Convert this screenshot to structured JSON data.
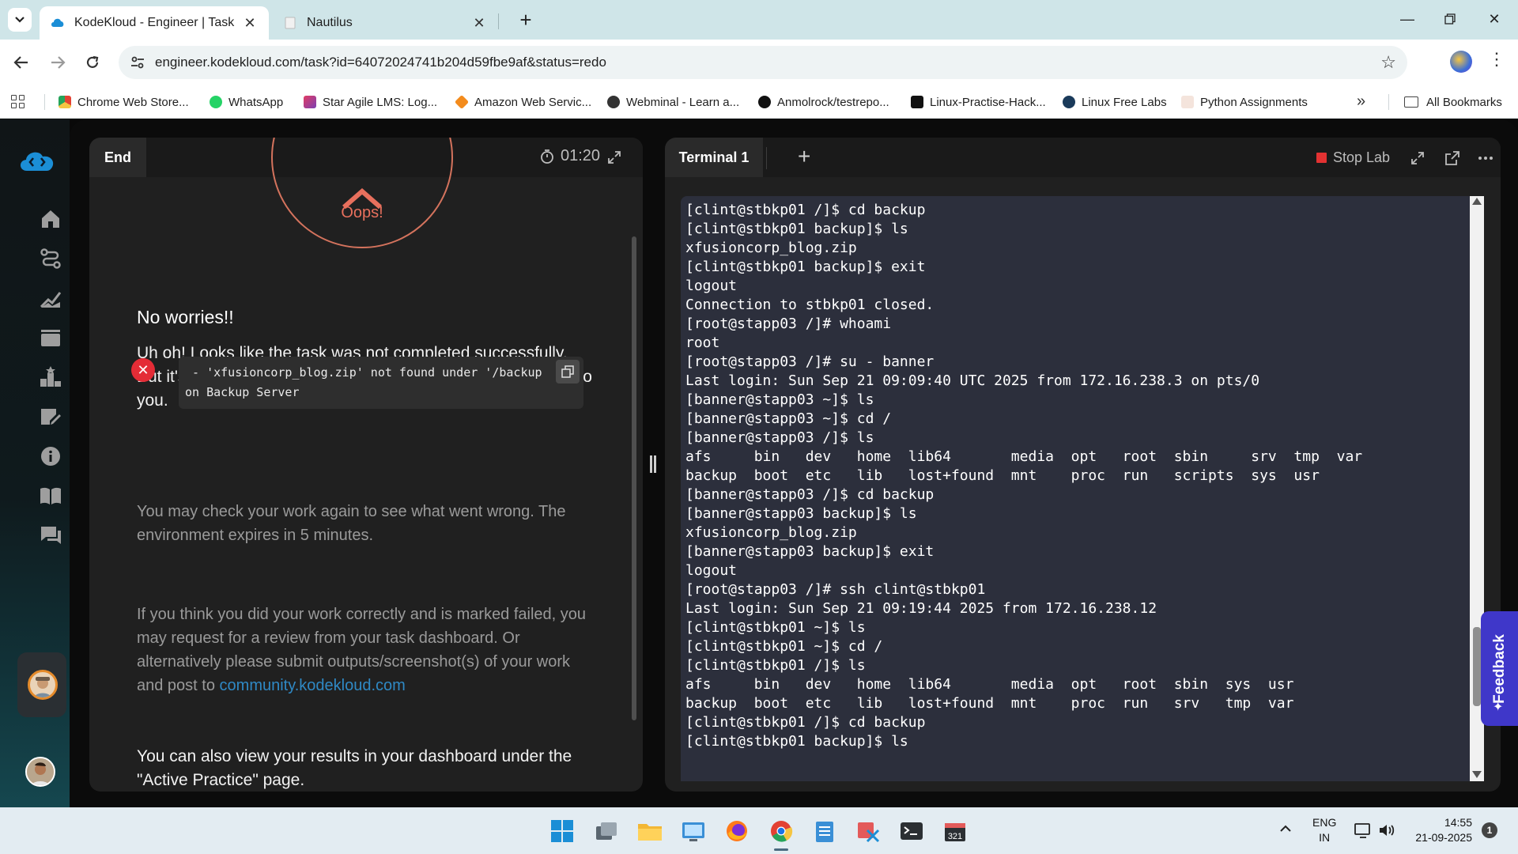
{
  "browser": {
    "tabs": [
      {
        "title": "KodeKloud - Engineer | Task",
        "active": true
      },
      {
        "title": "Nautilus",
        "active": false
      }
    ],
    "url": "engineer.kodekloud.com/task?id=64072024741b204d59fbe9af&status=redo",
    "bookmarks": [
      {
        "label": "Chrome Web Store...",
        "color": "#e34133"
      },
      {
        "label": "WhatsApp",
        "color": "#25d366"
      },
      {
        "label": "Star Agile LMS: Log...",
        "color": "#7b3fb3"
      },
      {
        "label": "Amazon Web Servic...",
        "color": "#f38b1c"
      },
      {
        "label": "Webminal - Learn a...",
        "color": "#333333"
      },
      {
        "label": "Anmolrock/testrepo...",
        "color": "#111111"
      },
      {
        "label": "Linux-Practise-Hack...",
        "color": "#111111"
      },
      {
        "label": "Linux Free Labs",
        "color": "#1a3a5a"
      },
      {
        "label": "Python Assignments",
        "color": "#cfa38a"
      }
    ],
    "all_bookmarks": "All Bookmarks"
  },
  "task_panel": {
    "tab_label": "End",
    "timer": "01:20",
    "oops": "Oops!",
    "heading": "No worries!!",
    "message": "Uh oh! Looks like the task was not completed successfully. But it's Ok. You can try again next time this task is assigned to you.",
    "error_text": " - 'xfusioncorp_blog.zip' not found under '/backup\non Backup Server",
    "check_note": "You may check your work again to see what went wrong. The environment expires in 5 minutes.",
    "review_note": "If you think you did your work correctly and is marked failed, you may request for a review from your task dashboard. Or alternatively please submit outputs/screenshot(s) of your work and post to ",
    "community_link": "community.kodekloud.com",
    "results_note": "You can also view your results in your dashboard under the \"Active Practice\" page."
  },
  "terminal_panel": {
    "tab_label": "Terminal 1",
    "stop_lab": "Stop Lab",
    "lines": [
      "[clint@stbkp01 /]$ cd backup",
      "[clint@stbkp01 backup]$ ls",
      "xfusioncorp_blog.zip",
      "[clint@stbkp01 backup]$ exit",
      "logout",
      "Connection to stbkp01 closed.",
      "[root@stapp03 /]# whoami",
      "root",
      "[root@stapp03 /]# su - banner",
      "Last login: Sun Sep 21 09:09:40 UTC 2025 from 172.16.238.3 on pts/0",
      "[banner@stapp03 ~]$ ls",
      "[banner@stapp03 ~]$ cd /",
      "[banner@stapp03 /]$ ls",
      "afs     bin   dev   home  lib64       media  opt   root  sbin     srv  tmp  var",
      "backup  boot  etc   lib   lost+found  mnt    proc  run   scripts  sys  usr",
      "[banner@stapp03 /]$ cd backup",
      "[banner@stapp03 backup]$ ls",
      "xfusioncorp_blog.zip",
      "[banner@stapp03 backup]$ exit",
      "logout",
      "[root@stapp03 /]# ssh clint@stbkp01",
      "Last login: Sun Sep 21 09:19:44 2025 from 172.16.238.12",
      "[clint@stbkp01 ~]$ ls",
      "[clint@stbkp01 ~]$ cd /",
      "[clint@stbkp01 /]$ ls",
      "afs     bin   dev   home  lib64       media  opt   root  sbin  sys  usr",
      "backup  boot  etc   lib   lost+found  mnt    proc  run   srv   tmp  var",
      "[clint@stbkp01 /]$ cd backup",
      "[clint@stbkp01 backup]$ ls"
    ]
  },
  "feedback": "Feedback",
  "taskbar": {
    "lang_top": "ENG",
    "lang_bottom": "IN",
    "time": "14:55",
    "date": "21-09-2025",
    "notifications": "1"
  }
}
